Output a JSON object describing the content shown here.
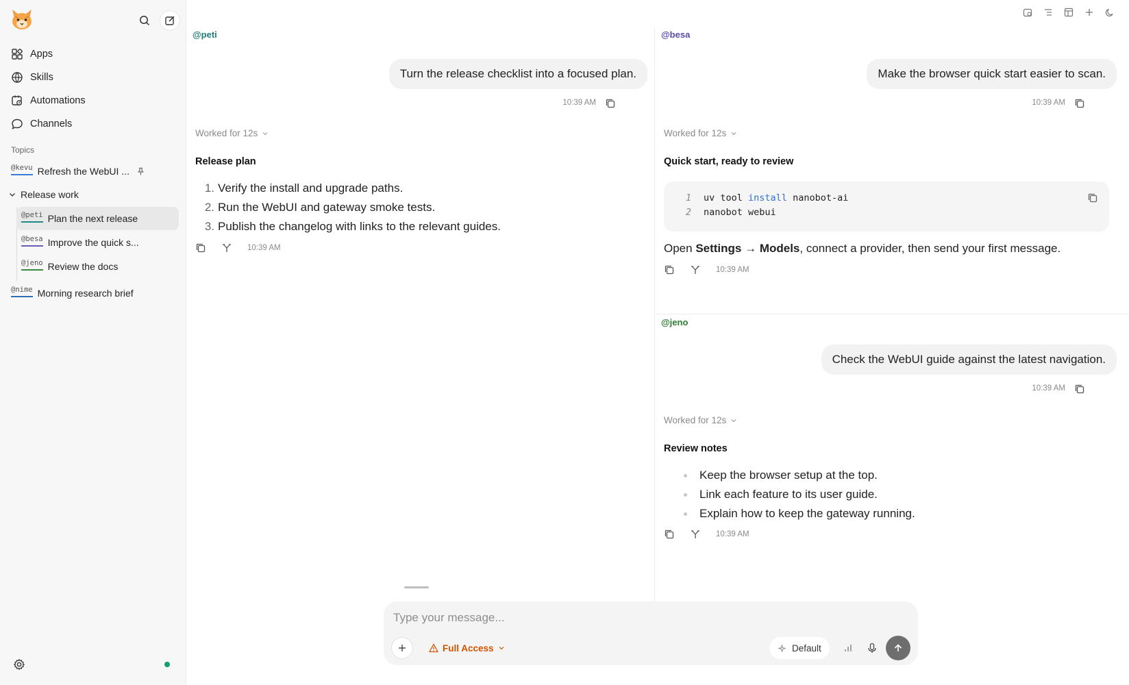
{
  "sidebar": {
    "nav": [
      {
        "label": "Apps",
        "icon": "apps-icon"
      },
      {
        "label": "Skills",
        "icon": "skills-icon"
      },
      {
        "label": "Automations",
        "icon": "automations-icon"
      },
      {
        "label": "Channels",
        "icon": "channels-icon"
      }
    ],
    "topics_label": "Topics",
    "topics": [
      {
        "handle": "@kevu",
        "label": "Refresh the WebUI ...",
        "pinned": true
      },
      {
        "group": "Release work"
      },
      {
        "handle": "@peti",
        "label": "Plan the next release"
      },
      {
        "handle": "@besa",
        "label": "Improve the quick s..."
      },
      {
        "handle": "@jeno",
        "label": "Review the docs"
      },
      {
        "handle": "@nime",
        "label": "Morning research brief"
      }
    ]
  },
  "panes": {
    "left": {
      "handle": "@peti",
      "user_message": "Turn the release checklist into a focused plan.",
      "user_time": "10:39 AM",
      "worked": "Worked for 12s",
      "title": "Release plan",
      "items": [
        "Verify the install and upgrade paths.",
        "Run the WebUI and gateway smoke tests.",
        "Publish the changelog with links to the relevant guides."
      ],
      "resp_time": "10:39 AM"
    },
    "top_right": {
      "handle": "@besa",
      "user_message": "Make the browser quick start easier to scan.",
      "user_time": "10:39 AM",
      "worked": "Worked for 12s",
      "title": "Quick start, ready to review",
      "code": {
        "line1_nums": "1",
        "line1_a": "uv tool ",
        "line1_kw": "install",
        "line1_b": " nanobot-ai",
        "line2_nums": "2",
        "line2": "nanobot webui"
      },
      "para_a": "Open ",
      "para_b1": "Settings",
      "para_arrow": " → ",
      "para_b2": "Models",
      "para_c": ", connect a provider, then send your first message.",
      "resp_time": "10:39 AM"
    },
    "bottom_right": {
      "handle": "@jeno",
      "user_message": "Check the WebUI guide against the latest navigation.",
      "user_time": "10:39 AM",
      "worked": "Worked for 12s",
      "title": "Review notes",
      "items": [
        "Keep the browser setup at the top.",
        "Link each feature to its user guide.",
        "Explain how to keep the gateway running."
      ],
      "resp_time": "10:39 AM"
    }
  },
  "composer": {
    "placeholder": "Type your message...",
    "access_label": "Full Access",
    "model_label": "Default"
  },
  "colors": {
    "accent_warning": "#d35400",
    "status_online": "#12a06b",
    "code_keyword": "#2f6fd6"
  }
}
